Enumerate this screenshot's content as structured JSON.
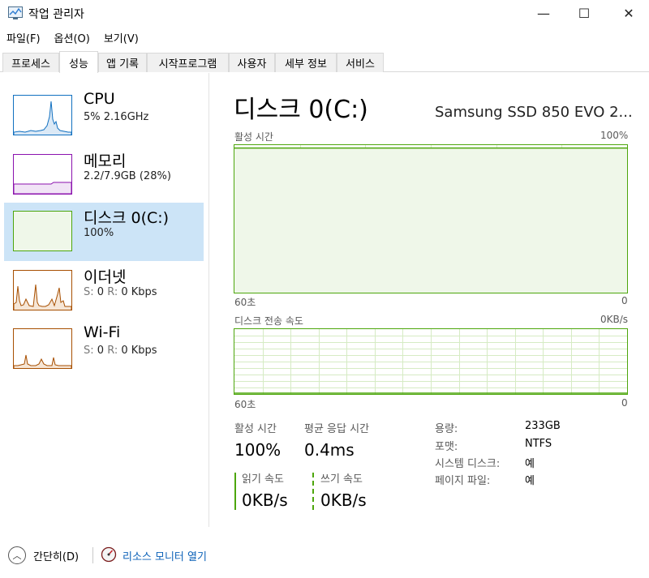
{
  "window": {
    "title": "작업 관리자",
    "minimize": "—",
    "maximize": "☐",
    "close": "✕"
  },
  "menu": [
    "파일(F)",
    "옵션(O)",
    "보기(V)"
  ],
  "tabs": [
    "프로세스",
    "성능",
    "앱 기록",
    "시작프로그램",
    "사용자",
    "세부 정보",
    "서비스"
  ],
  "active_tab": "성능",
  "sidebar": {
    "items": [
      {
        "title": "CPU",
        "subtitle": "5% 2.16GHz",
        "color": "#1170c0"
      },
      {
        "title": "메모리",
        "subtitle": "2.2/7.9GB (28%)",
        "color": "#8b12ae"
      },
      {
        "title": "디스크 0(C:)",
        "subtitle": "100%",
        "color": "#4da60c"
      },
      {
        "title": "이더넷",
        "s_label": "S:",
        "s_value": "0",
        "r_label": "R:",
        "r_value": "0 Kbps",
        "color": "#a74f01"
      },
      {
        "title": "Wi-Fi",
        "s_label": "S:",
        "s_value": "0",
        "r_label": "R:",
        "r_value": "0 Kbps",
        "color": "#a74f01"
      }
    ]
  },
  "detail": {
    "title": "디스크 0(C:)",
    "model": "Samsung SSD 850 EVO 2...",
    "graph1": {
      "label": "활성 시간",
      "max": "100%",
      "x_left": "60초",
      "x_right": "0",
      "level_percent": 98
    },
    "graph2": {
      "label": "디스크 전송 속도",
      "max": "0KB/s",
      "x_left": "60초",
      "x_right": "0",
      "level_percent": 0
    },
    "stats": {
      "active_time_label": "활성 시간",
      "active_time_value": "100%",
      "response_label": "평균 응답 시간",
      "response_value": "0.4ms",
      "read_label": "읽기 속도",
      "read_value": "0KB/s",
      "write_label": "쓰기 속도",
      "write_value": "0KB/s"
    },
    "properties": [
      {
        "key": "용량:",
        "value": "233GB"
      },
      {
        "key": "포맷:",
        "value": "NTFS"
      },
      {
        "key": "시스템 디스크:",
        "value": "예"
      },
      {
        "key": "페이지 파일:",
        "value": "예"
      }
    ]
  },
  "footer": {
    "fewer_details": "간단히(D)",
    "resource_monitor": "리소스 모니터 열기"
  },
  "colors": {
    "disk_green": "#4da60c",
    "disk_fill": "#eff7e9",
    "selected_bg": "#cce4f7",
    "link": "#0b61b8"
  }
}
